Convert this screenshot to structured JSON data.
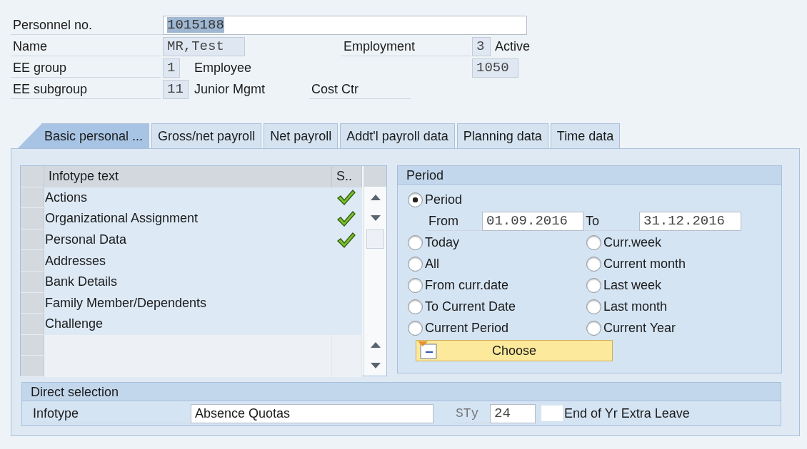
{
  "header": {
    "personnel_no": {
      "label": "Personnel no.",
      "value": "1015188"
    },
    "name": {
      "label": "Name",
      "value": "MR,Test"
    },
    "employment": {
      "label": "Employment",
      "code": "3",
      "text": "Active"
    },
    "ee_group": {
      "label": "EE group",
      "code": "1",
      "text": "Employee"
    },
    "field_1050": {
      "value": "1050"
    },
    "ee_subgroup": {
      "label": "EE subgroup",
      "code": "11",
      "text": "Junior Mgmt"
    },
    "cost_ctr": {
      "label": "Cost Ctr"
    }
  },
  "tabs": [
    {
      "label": "Basic personal ...",
      "selected": true
    },
    {
      "label": "Gross/net payroll",
      "selected": false
    },
    {
      "label": "Net payroll",
      "selected": false
    },
    {
      "label": "Addt'l payroll data",
      "selected": false
    },
    {
      "label": "Planning data",
      "selected": false
    },
    {
      "label": "Time data",
      "selected": false
    }
  ],
  "infotypes": {
    "columns": [
      "Infotype text",
      "S.."
    ],
    "rows": [
      {
        "text": "Actions",
        "checked": true
      },
      {
        "text": "Organizational Assignment",
        "checked": true
      },
      {
        "text": "Personal Data",
        "checked": true
      },
      {
        "text": "Addresses",
        "checked": false
      },
      {
        "text": "Bank Details",
        "checked": false
      },
      {
        "text": "Family Member/Dependents",
        "checked": false
      },
      {
        "text": "Challenge",
        "checked": false
      }
    ]
  },
  "period": {
    "title": "Period",
    "main": {
      "label": "Period",
      "selected": true
    },
    "from_label": "From",
    "from_value": "01.09.2016",
    "to_label": "To",
    "to_value": "31.12.2016",
    "left_options": [
      {
        "label": "Today",
        "selected": false
      },
      {
        "label": "All",
        "selected": false
      },
      {
        "label": "From curr.date",
        "selected": false
      },
      {
        "label": "To Current Date",
        "selected": false
      },
      {
        "label": "Current Period",
        "selected": false
      }
    ],
    "right_options": [
      {
        "label": "Curr.week",
        "selected": false
      },
      {
        "label": "Current month",
        "selected": false
      },
      {
        "label": "Last week",
        "selected": false
      },
      {
        "label": "Last month",
        "selected": false
      },
      {
        "label": "Current Year",
        "selected": false
      }
    ],
    "choose_button": "Choose"
  },
  "direct_selection": {
    "title": "Direct selection",
    "infotype_label": "Infotype",
    "infotype_value": "Absence Quotas",
    "sty_label": "STy",
    "sty_value": "24",
    "subtype_text": "End of Yr Extra Leave"
  }
}
